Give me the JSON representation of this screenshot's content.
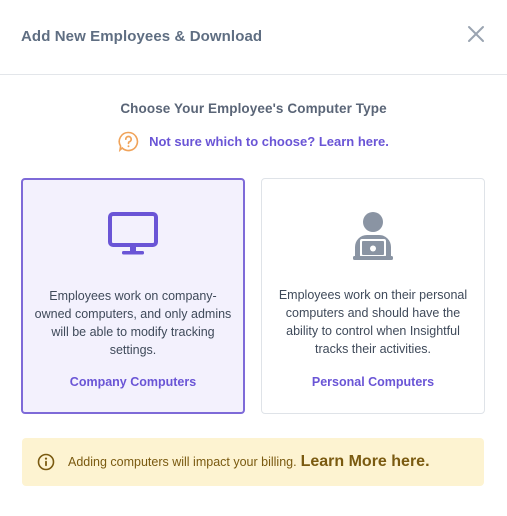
{
  "header": {
    "title": "Add New Employees & Download",
    "close_icon": "close-icon"
  },
  "main": {
    "subtitle": "Choose Your Employee's Computer Type",
    "help": {
      "icon": "question-icon",
      "link_text": "Not sure which to choose? Learn here."
    },
    "cards": [
      {
        "icon": "monitor-icon",
        "description": "Employees work on company-owned computers, and only admins will be able to modify tracking settings.",
        "label": "Company Computers",
        "selected": true
      },
      {
        "icon": "user-laptop-icon",
        "description": "Employees work on their personal computers and should have the ability to control when Insightful tracks their activities.",
        "label": "Personal Computers",
        "selected": false
      }
    ]
  },
  "notice": {
    "icon": "info-icon",
    "text": "Adding computers will impact your billing.",
    "link_text": "Learn More here."
  },
  "colors": {
    "accent": "#6a55d6",
    "selected_border": "#7e6ad8",
    "selected_bg": "#f3f1fd",
    "notice_bg": "#fdf3d1",
    "help_icon": "#f0a35a",
    "user_icon": "#8a94a3"
  }
}
